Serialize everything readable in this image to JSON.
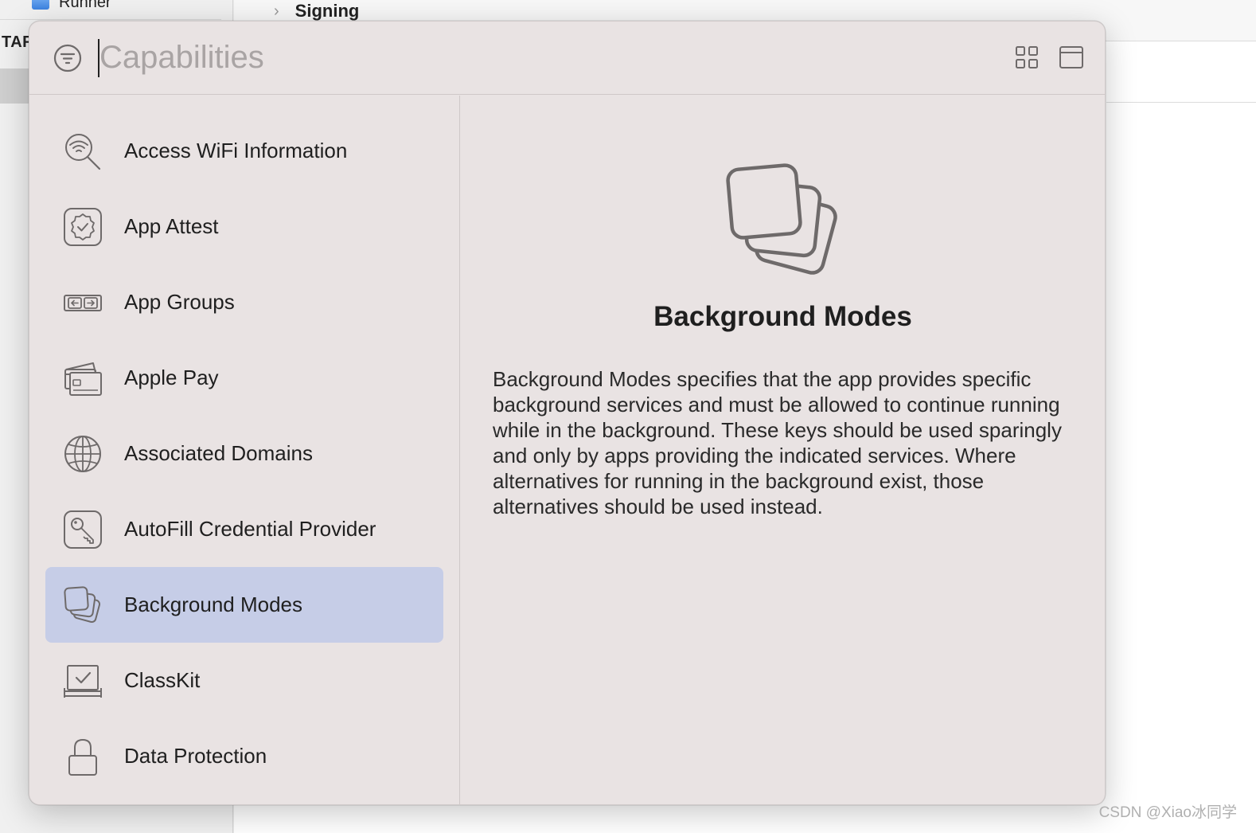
{
  "background": {
    "project_item": "Runner",
    "targets_header": "TAR",
    "section_title": "Signing"
  },
  "search": {
    "placeholder": "Capabilities",
    "value": ""
  },
  "capabilities": [
    {
      "label": "Access WiFi Information",
      "icon": "wifi-search-icon",
      "selected": false
    },
    {
      "label": "App Attest",
      "icon": "badge-check-icon",
      "selected": false
    },
    {
      "label": "App Groups",
      "icon": "app-groups-icon",
      "selected": false
    },
    {
      "label": "Apple Pay",
      "icon": "cards-icon",
      "selected": false
    },
    {
      "label": "Associated Domains",
      "icon": "globe-icon",
      "selected": false
    },
    {
      "label": "AutoFill Credential Provider",
      "icon": "key-icon",
      "selected": false
    },
    {
      "label": "Background Modes",
      "icon": "stacked-squares-icon",
      "selected": true
    },
    {
      "label": "ClassKit",
      "icon": "classkit-icon",
      "selected": false
    },
    {
      "label": "Data Protection",
      "icon": "lock-icon",
      "selected": false
    }
  ],
  "detail": {
    "title": "Background Modes",
    "description": "Background Modes specifies that the app provides specific background services and must be allowed to continue running while in the background. These keys should be used sparingly and only by apps providing the indicated services. Where alternatives for running in the background exist, those alternatives should be used instead."
  },
  "colors": {
    "panel_bg": "#e9e3e3",
    "selection": "#c6cde7",
    "icon_stroke": "#6e6a6a"
  },
  "watermark": "CSDN @Xiao冰同学"
}
